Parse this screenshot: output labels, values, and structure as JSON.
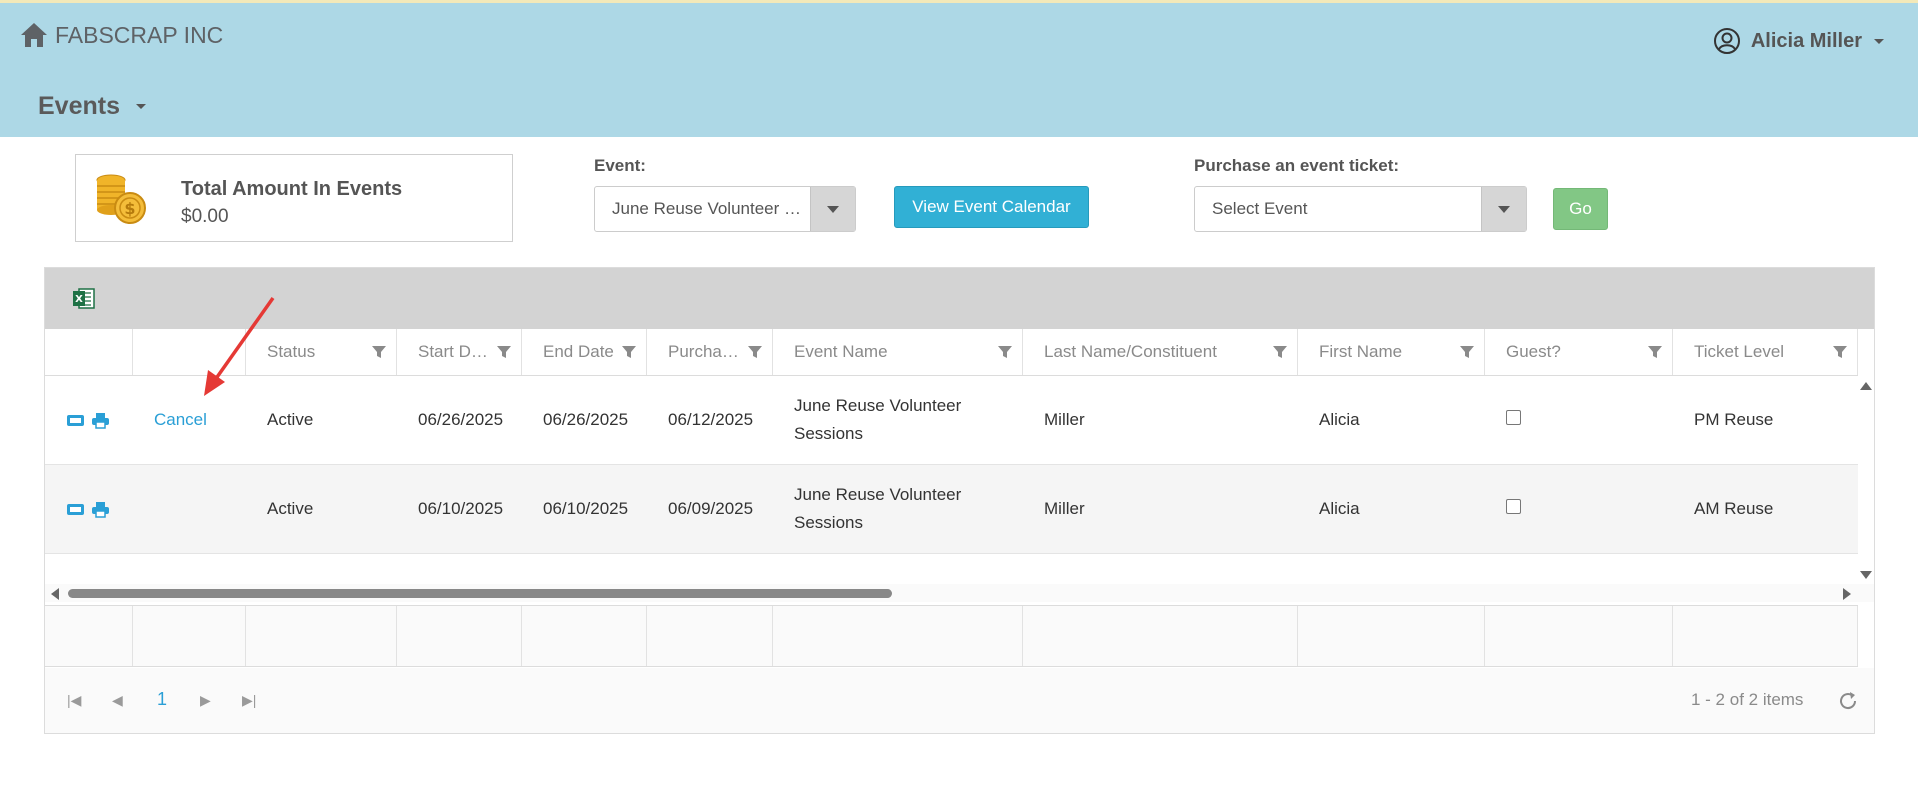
{
  "header": {
    "brand": "FABSCRAP INC",
    "user_name": "Alicia Miller",
    "menu_title": "Events"
  },
  "summary": {
    "title": "Total Amount In Events",
    "value": "$0.00"
  },
  "event_filter": {
    "label": "Event:",
    "selected": "June Reuse Volunteer Sessions"
  },
  "calendar_button": "View Event Calendar",
  "purchase": {
    "label": "Purchase an event ticket:",
    "selected": "Select Event",
    "go_label": "Go"
  },
  "grid": {
    "columns": [
      "Status",
      "Start Date",
      "End Date",
      "Purchase Date",
      "Event Name",
      "Last Name/Constituent",
      "First Name",
      "Guest?",
      "Ticket Level"
    ],
    "rows": [
      {
        "action": "Cancel",
        "status": "Active",
        "start": "06/26/2025",
        "end": "06/26/2025",
        "purchased": "06/12/2025",
        "event_name": "June Reuse Volunteer Sessions",
        "last_name": "Miller",
        "first_name": "Alicia",
        "guest": false,
        "ticket_level": "PM Reuse"
      },
      {
        "action": "",
        "status": "Active",
        "start": "06/10/2025",
        "end": "06/10/2025",
        "purchased": "06/09/2025",
        "event_name": "June Reuse Volunteer Sessions",
        "last_name": "Miller",
        "first_name": "Alicia",
        "guest": false,
        "ticket_level": "AM Reuse"
      }
    ]
  },
  "pager": {
    "page": "1",
    "info": "1 - 2 of 2 items"
  },
  "colors": {
    "header_bg": "#add8e6",
    "primary_button": "#31b0d5",
    "go_button": "#82c785",
    "link": "#2a9fd6",
    "annotation_arrow": "#e53935"
  }
}
